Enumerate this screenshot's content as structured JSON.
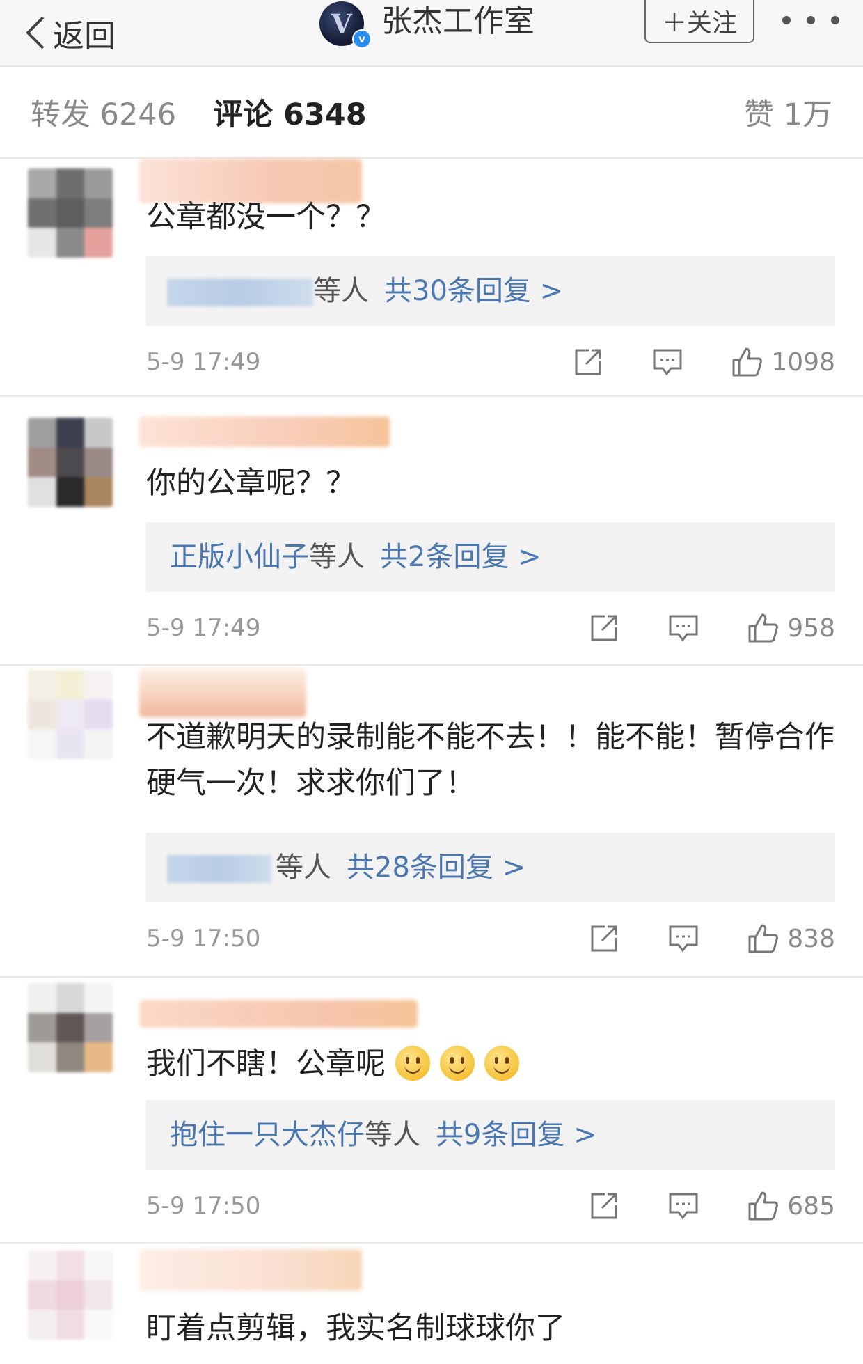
{
  "header": {
    "back_label": "返回",
    "avatar_letter": "V",
    "verified_mark": "v",
    "title": "张杰工作室",
    "follow_label": "＋关注"
  },
  "tabs": {
    "repost": "转发 6246",
    "comment": "评论 6348",
    "like": "赞 1万"
  },
  "comments": [
    {
      "text": "公章都没一个？？",
      "reply_names": "",
      "reply_suffix": "等人",
      "reply_count": "共30条回复 >",
      "time": "5-9 17:49",
      "likes": "1098"
    },
    {
      "text": "你的公章呢？？",
      "reply_names": "正版小仙子",
      "reply_suffix": "等人",
      "reply_count": "共2条回复 >",
      "time": "5-9 17:49",
      "likes": "958"
    },
    {
      "text": "不道歉明天的录制能不能不去！！能不能！暂停合作硬气一次！求求你们了！",
      "reply_names": "",
      "reply_suffix": "等人",
      "reply_count": "共28条回复 >",
      "time": "5-9 17:50",
      "likes": "838"
    },
    {
      "text": "我们不瞎！公章呢",
      "reply_names": "抱住一只大杰仔",
      "reply_suffix": "等人",
      "reply_count": "共9条回复 >",
      "time": "5-9 17:50",
      "likes": "685"
    },
    {
      "text": "盯着点剪辑，我实名制球球你了"
    }
  ]
}
